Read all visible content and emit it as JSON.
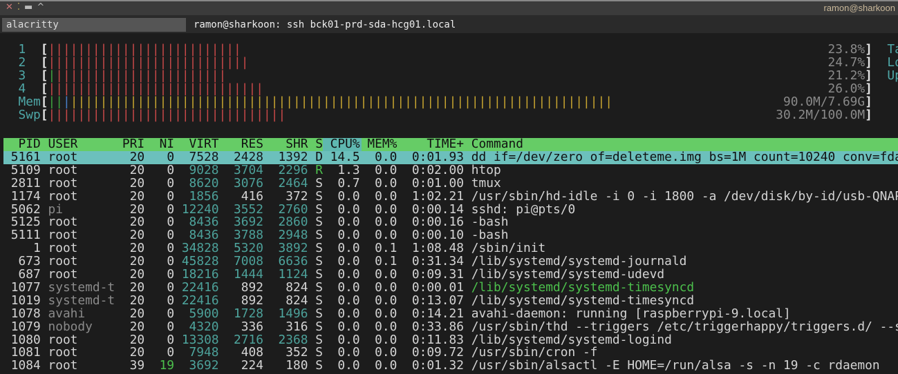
{
  "window": {
    "controls": [
      "✕",
      "⁚",
      "▬",
      "^"
    ],
    "user_host": "ramon@sharkoon",
    "tab_app": "alacritty",
    "tab_title": "ramon@sharkoon: ssh bck01-prd-sda-hcg01.local"
  },
  "meters": [
    {
      "label": "1",
      "value": "23.8%",
      "bars": [
        [
          "red",
          26
        ]
      ]
    },
    {
      "label": "2",
      "value": "24.7%",
      "bars": [
        [
          "red",
          27
        ]
      ]
    },
    {
      "label": "3",
      "value": "21.2%",
      "bars": [
        [
          "green",
          1
        ],
        [
          "red",
          23
        ]
      ]
    },
    {
      "label": "4",
      "value": "26.0%",
      "bars": [
        [
          "red",
          29
        ]
      ]
    },
    {
      "label": "Mem",
      "value": "90.0M/7.69G",
      "bars": [
        [
          "green",
          2
        ],
        [
          "blue",
          1
        ],
        [
          "yellow",
          73
        ]
      ]
    },
    {
      "label": "Swp",
      "value": "30.2M/100.0M",
      "bars": [
        [
          "red",
          32
        ]
      ]
    }
  ],
  "side_meters": [
    "Ta",
    "Lo",
    "Up"
  ],
  "colors": {
    "header_bg": "#66cc66",
    "selected_bg": "#6cc0bc",
    "accent_teal": "#4fa8a8"
  },
  "table": {
    "headers": {
      "pid": "PID",
      "user": "USER",
      "pri": "PRI",
      "ni": "NI",
      "virt": "VIRT",
      "res": "RES",
      "shr": "SHR",
      "s": "S",
      "cpu": "CPU%",
      "mem": "MEM%",
      "time": "TIME+",
      "cmd": "Command"
    },
    "sort_column": "cpu",
    "selected_index": 0,
    "rows": [
      {
        "pid": "5161",
        "user": "root",
        "pri": "20",
        "ni": "0",
        "virt": "7528",
        "res": "2428",
        "shr": "1392",
        "s": "D",
        "cpu": "14.5",
        "mem": "0.0",
        "time": "0:01.93",
        "cmd": "dd if=/dev/zero of=deleteme.img bs=1M count=10240 conv=fda"
      },
      {
        "pid": "5109",
        "user": "root",
        "pri": "20",
        "ni": "0",
        "virt": "9028",
        "res": "3704",
        "shr": "2296",
        "s": "R",
        "cpu": "1.3",
        "mem": "0.0",
        "time": "0:02.00",
        "cmd": "htop"
      },
      {
        "pid": "2811",
        "user": "root",
        "pri": "20",
        "ni": "0",
        "virt": "8620",
        "res": "3076",
        "shr": "2464",
        "s": "S",
        "cpu": "0.7",
        "mem": "0.0",
        "time": "0:01.00",
        "cmd": "tmux"
      },
      {
        "pid": "1174",
        "user": "root",
        "pri": "20",
        "ni": "0",
        "virt": "1856",
        "res": "416",
        "shr": "372",
        "s": "S",
        "cpu": "0.0",
        "mem": "0.0",
        "time": "1:02.21",
        "cmd": "/usr/sbin/hd-idle -i 0 -i 1800 -a /dev/disk/by-id/usb-QNAP"
      },
      {
        "pid": "5062",
        "user": "pi",
        "pri": "20",
        "ni": "0",
        "virt": "12240",
        "res": "3552",
        "shr": "2760",
        "s": "S",
        "cpu": "0.0",
        "mem": "0.0",
        "time": "0:00.14",
        "cmd": "sshd: pi@pts/0"
      },
      {
        "pid": "5125",
        "user": "root",
        "pri": "20",
        "ni": "0",
        "virt": "8436",
        "res": "3692",
        "shr": "2860",
        "s": "S",
        "cpu": "0.0",
        "mem": "0.0",
        "time": "0:00.16",
        "cmd": "-bash"
      },
      {
        "pid": "5111",
        "user": "root",
        "pri": "20",
        "ni": "0",
        "virt": "8436",
        "res": "3788",
        "shr": "2948",
        "s": "S",
        "cpu": "0.0",
        "mem": "0.0",
        "time": "0:00.10",
        "cmd": "-bash"
      },
      {
        "pid": "1",
        "user": "root",
        "pri": "20",
        "ni": "0",
        "virt": "34828",
        "res": "5320",
        "shr": "3892",
        "s": "S",
        "cpu": "0.0",
        "mem": "0.1",
        "time": "1:08.48",
        "cmd": "/sbin/init"
      },
      {
        "pid": "673",
        "user": "root",
        "pri": "20",
        "ni": "0",
        "virt": "45828",
        "res": "7008",
        "shr": "6636",
        "s": "S",
        "cpu": "0.0",
        "mem": "0.1",
        "time": "0:31.34",
        "cmd": "/lib/systemd/systemd-journald"
      },
      {
        "pid": "687",
        "user": "root",
        "pri": "20",
        "ni": "0",
        "virt": "18216",
        "res": "1444",
        "shr": "1124",
        "s": "S",
        "cpu": "0.0",
        "mem": "0.0",
        "time": "0:09.31",
        "cmd": "/lib/systemd/systemd-udevd"
      },
      {
        "pid": "1077",
        "user": "systemd-t",
        "pri": "20",
        "ni": "0",
        "virt": "22416",
        "res": "892",
        "shr": "824",
        "s": "S",
        "cpu": "0.0",
        "mem": "0.0",
        "time": "0:00.01",
        "cmd": "/lib/systemd/systemd-timesyncd",
        "thread": true
      },
      {
        "pid": "1019",
        "user": "systemd-t",
        "pri": "20",
        "ni": "0",
        "virt": "22416",
        "res": "892",
        "shr": "824",
        "s": "S",
        "cpu": "0.0",
        "mem": "0.0",
        "time": "0:13.07",
        "cmd": "/lib/systemd/systemd-timesyncd"
      },
      {
        "pid": "1078",
        "user": "avahi",
        "pri": "20",
        "ni": "0",
        "virt": "5900",
        "res": "1728",
        "shr": "1496",
        "s": "S",
        "cpu": "0.0",
        "mem": "0.0",
        "time": "0:14.21",
        "cmd": "avahi-daemon: running [raspberrypi-9.local]"
      },
      {
        "pid": "1079",
        "user": "nobody",
        "pri": "20",
        "ni": "0",
        "virt": "4320",
        "res": "336",
        "shr": "316",
        "s": "S",
        "cpu": "0.0",
        "mem": "0.0",
        "time": "0:33.86",
        "cmd": "/usr/sbin/thd --triggers /etc/triggerhappy/triggers.d/ --s"
      },
      {
        "pid": "1080",
        "user": "root",
        "pri": "20",
        "ni": "0",
        "virt": "13308",
        "res": "2716",
        "shr": "2368",
        "s": "S",
        "cpu": "0.0",
        "mem": "0.0",
        "time": "0:11.83",
        "cmd": "/lib/systemd/systemd-logind"
      },
      {
        "pid": "1081",
        "user": "root",
        "pri": "20",
        "ni": "0",
        "virt": "7948",
        "res": "408",
        "shr": "352",
        "s": "S",
        "cpu": "0.0",
        "mem": "0.0",
        "time": "0:09.72",
        "cmd": "/usr/sbin/cron -f"
      },
      {
        "pid": "1084",
        "user": "root",
        "pri": "39",
        "ni": "19",
        "virt": "3692",
        "res": "224",
        "shr": "180",
        "s": "S",
        "cpu": "0.0",
        "mem": "0.0",
        "time": "0:01.32",
        "cmd": "/usr/sbin/alsactl -E HOME=/run/alsa -s -n 19 -c rdaemon"
      }
    ]
  }
}
